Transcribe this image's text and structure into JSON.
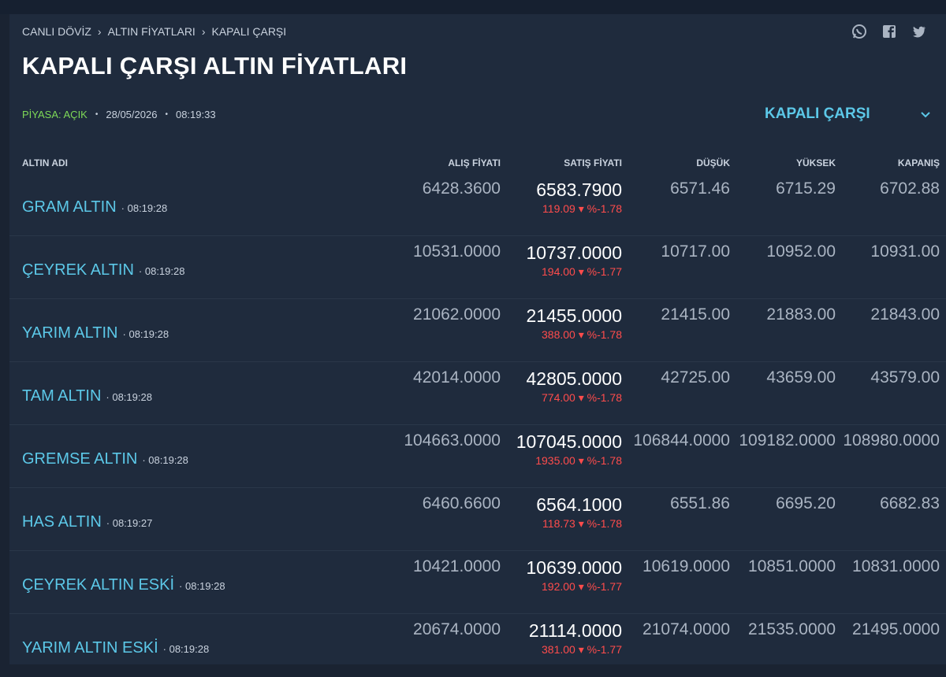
{
  "breadcrumb": [
    "CANLI DÖVİZ",
    "ALTIN FİYATLARI",
    "KAPALI ÇARŞI"
  ],
  "share_icons": [
    "whatsapp-icon",
    "facebook-icon",
    "twitter-icon"
  ],
  "title": "KAPALI ÇARŞI ALTIN FİYATLARI",
  "status": {
    "market": "PİYASA: AÇIK",
    "date": "28/05/2026",
    "time": "08:19:33"
  },
  "selector": {
    "value": "KAPALI ÇARŞI"
  },
  "columns": {
    "name": "ALTIN ADI",
    "alis": "ALIŞ FİYATI",
    "satis": "SATIŞ FİYATI",
    "dusuk": "DÜŞÜK",
    "yuksek": "YÜKSEK",
    "kapanis": "KAPANIŞ"
  },
  "rows": [
    {
      "name": "GRAM ALTIN",
      "time": "08:19:28",
      "alis": "6428.3600",
      "satis": "6583.7900",
      "change": "119.09",
      "pct": "%-1.78",
      "dusuk": "6571.46",
      "yuksek": "6715.29",
      "kapanis": "6702.88"
    },
    {
      "name": "ÇEYREK ALTIN",
      "time": "08:19:28",
      "alis": "10531.0000",
      "satis": "10737.0000",
      "change": "194.00",
      "pct": "%-1.77",
      "dusuk": "10717.00",
      "yuksek": "10952.00",
      "kapanis": "10931.00"
    },
    {
      "name": "YARIM ALTIN",
      "time": "08:19:28",
      "alis": "21062.0000",
      "satis": "21455.0000",
      "change": "388.00",
      "pct": "%-1.78",
      "dusuk": "21415.00",
      "yuksek": "21883.00",
      "kapanis": "21843.00"
    },
    {
      "name": "TAM ALTIN",
      "time": "08:19:28",
      "alis": "42014.0000",
      "satis": "42805.0000",
      "change": "774.00",
      "pct": "%-1.78",
      "dusuk": "42725.00",
      "yuksek": "43659.00",
      "kapanis": "43579.00"
    },
    {
      "name": "GREMSE ALTIN",
      "time": "08:19:28",
      "alis": "104663.0000",
      "satis": "107045.0000",
      "change": "1935.00",
      "pct": "%-1.78",
      "dusuk": "106844.0000",
      "yuksek": "109182.0000",
      "kapanis": "108980.0000"
    },
    {
      "name": "HAS ALTIN",
      "time": "08:19:27",
      "alis": "6460.6600",
      "satis": "6564.1000",
      "change": "118.73",
      "pct": "%-1.78",
      "dusuk": "6551.86",
      "yuksek": "6695.20",
      "kapanis": "6682.83"
    },
    {
      "name": "ÇEYREK ALTIN ESKİ",
      "time": "08:19:28",
      "alis": "10421.0000",
      "satis": "10639.0000",
      "change": "192.00",
      "pct": "%-1.77",
      "dusuk": "10619.0000",
      "yuksek": "10851.0000",
      "kapanis": "10831.0000"
    },
    {
      "name": "YARIM ALTIN ESKİ",
      "time": "08:19:28",
      "alis": "20674.0000",
      "satis": "21114.0000",
      "change": "381.00",
      "pct": "%-1.77",
      "dusuk": "21074.0000",
      "yuksek": "21535.0000",
      "kapanis": "21495.0000"
    }
  ]
}
